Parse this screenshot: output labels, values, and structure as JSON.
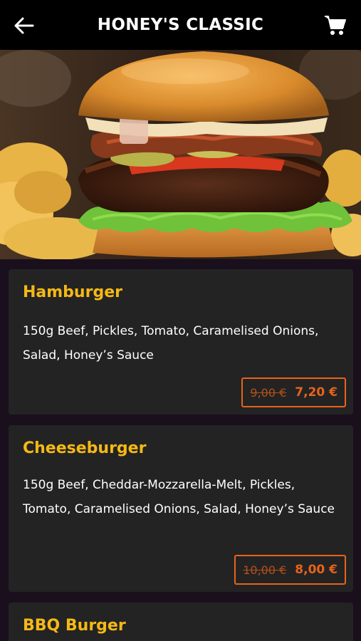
{
  "header": {
    "title": "HONEY'S CLASSIC",
    "back_icon": "arrow-left-icon",
    "cart_icon": "shopping-cart-icon"
  },
  "hero": {
    "alt": "burger-photo"
  },
  "menu": {
    "items": [
      {
        "name": "Hamburger",
        "description": "150g Beef, Pickles, Tomato, Caramelised Onions, Salad, Honey’s Sauce",
        "old_price": "9,00 €",
        "new_price": "7,20 €"
      },
      {
        "name": "Cheeseburger",
        "description": "150g Beef, Cheddar-Mozzarella-Melt, Pickles, Tomato, Caramelised Onions, Salad, Honey’s Sauce",
        "old_price": "10,00 €",
        "new_price": "8,00 €"
      },
      {
        "name": "BBQ Burger",
        "description": "",
        "old_price": "",
        "new_price": ""
      }
    ]
  },
  "colors": {
    "accent_yellow": "#f5b915",
    "price_orange": "#e8631a",
    "card_bg": "#232323"
  }
}
